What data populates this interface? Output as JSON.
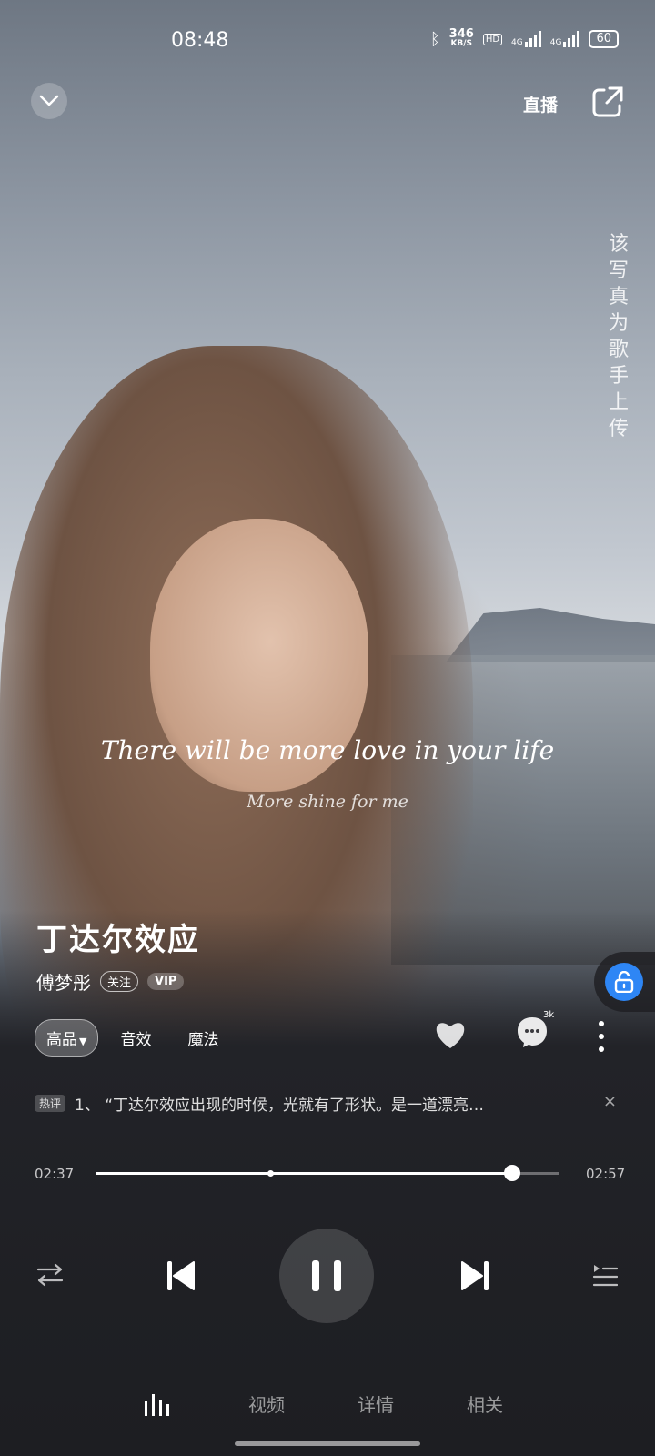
{
  "status": {
    "time": "08:48",
    "speed_top": "346",
    "speed_unit": "KB/S",
    "hd": "HD",
    "net1": "4G",
    "net2": "4G",
    "battery": "60"
  },
  "header": {
    "collapse_icon": "chevron-down-icon",
    "live_label": "直播",
    "share_icon": "share-icon"
  },
  "side_note": "该写真为歌手上传",
  "lyrics": {
    "current": "There will be more love in your life",
    "next": "More shine for me"
  },
  "song": {
    "title": "丁达尔效应",
    "artist": "傅梦彤",
    "follow_label": "关注",
    "vip_label": "VIP"
  },
  "options": {
    "quality": "高品",
    "effect": "音效",
    "magic": "魔法"
  },
  "actions": {
    "comment_badge": "3k"
  },
  "hot_comment": {
    "tag": "热评",
    "text": "1、 “丁达尔效应出现的时候，光就有了形状。是一道漂亮…",
    "close": "×"
  },
  "progress": {
    "current": "02:37",
    "total": "02:57",
    "fraction": 0.9,
    "highlight_mark": 0.37
  },
  "controls": {
    "loop_icon": "repeat-icon",
    "prev_icon": "skip-previous-icon",
    "play_icon": "pause-icon",
    "next_icon": "skip-next-icon",
    "playlist_icon": "playlist-icon"
  },
  "tabs": {
    "tab2": "视频",
    "tab3": "详情",
    "tab4": "相关"
  },
  "accent": {
    "lock_blue": "#2e86f5"
  }
}
